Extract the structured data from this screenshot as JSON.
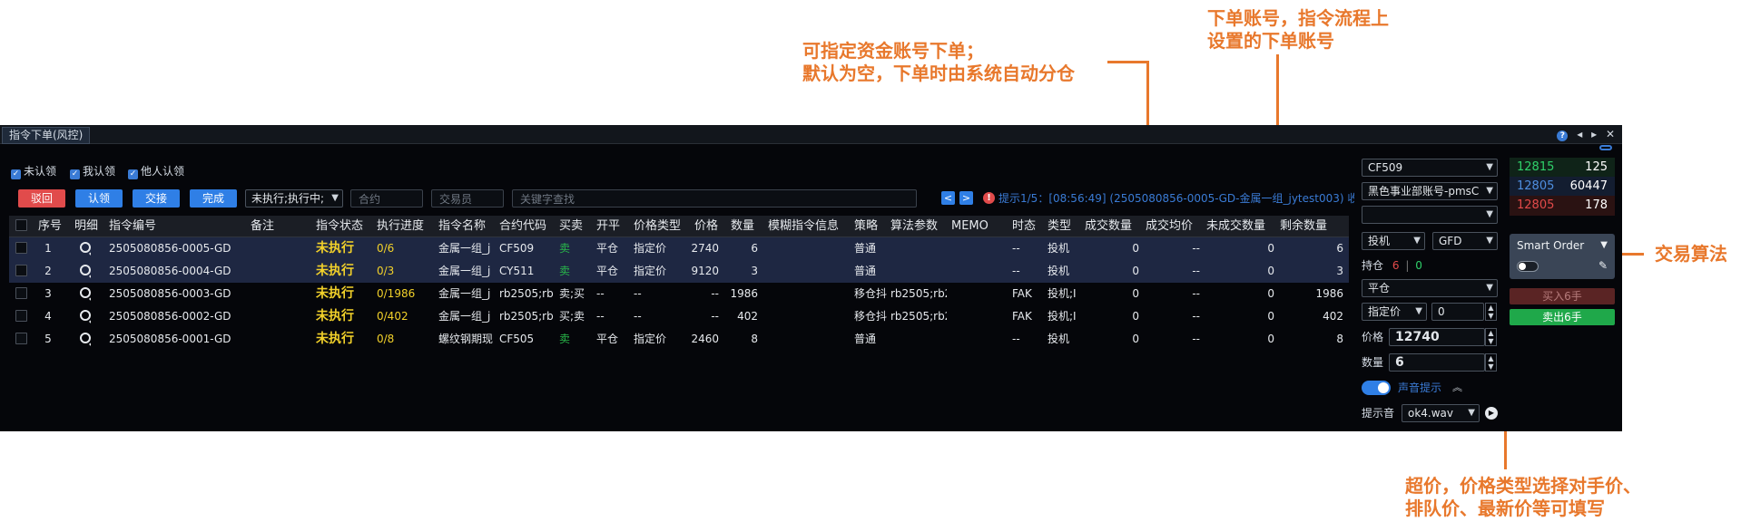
{
  "annotations": {
    "fund_account": [
      "可指定资金账号下单；",
      "默认为空，下单时由系统自动分仓"
    ],
    "order_account": [
      "下单账号，指令流程上",
      "设置的下单账号"
    ],
    "algo": "交易算法",
    "price": [
      "超价，价格类型选择对手价、",
      "排队价、最新价等可填写"
    ]
  },
  "window": {
    "tab": "指令下单(风控)",
    "icons": [
      "?",
      "◂",
      "▸",
      "✕"
    ]
  },
  "filters": {
    "checkboxes": [
      "未认领",
      "我认领",
      "他人认领"
    ],
    "check": "✓"
  },
  "buttons": {
    "reject": "驳回",
    "claim": "认领",
    "handover": "交接",
    "finish": "完成"
  },
  "search": {
    "status_select": "未执行;执行中;",
    "contract_placeholder": "合约",
    "trader_placeholder": "交易员",
    "keyword_placeholder": "关键字查找"
  },
  "notice": {
    "prev": "<",
    "next": ">",
    "text": "提示1/5：[08:56:49] (2505080856-0005-GD-金属一组_jytest003) 收"
  },
  "table": {
    "headers": [
      "序号",
      "明细",
      "指令编号",
      "备注",
      "指令状态",
      "执行进度",
      "指令名称",
      "合约代码",
      "买卖",
      "开平",
      "价格类型",
      "价格",
      "数量",
      "模糊指令信息",
      "策略",
      "算法参数",
      "MEMO",
      "时态",
      "类型",
      "成交数量",
      "成交均价",
      "未成交数量",
      "剩余数量"
    ],
    "rows": [
      {
        "seq": "1",
        "id": "2505080856-0005-GD",
        "note": "",
        "status": "未执行",
        "progress": "0/6",
        "name": "金属一组_j",
        "code": "CF509",
        "side": "卖",
        "oc": "平仓",
        "ptype": "指定价",
        "price": "2740",
        "qty": "6",
        "fuzzy": "",
        "strategy": "普通",
        "algo": "",
        "memo": "",
        "tif": "--",
        "type": "投机",
        "filled": "0",
        "avg": "--",
        "unfilled": "0",
        "remain": "6"
      },
      {
        "seq": "2",
        "id": "2505080856-0004-GD",
        "note": "",
        "status": "未执行",
        "progress": "0/3",
        "name": "金属一组_j",
        "code": "CY511",
        "side": "卖",
        "oc": "平仓",
        "ptype": "指定价",
        "price": "9120",
        "qty": "3",
        "fuzzy": "",
        "strategy": "普通",
        "algo": "",
        "memo": "",
        "tif": "--",
        "type": "投机",
        "filled": "0",
        "avg": "--",
        "unfilled": "0",
        "remain": "3"
      },
      {
        "seq": "3",
        "id": "2505080856-0003-GD",
        "note": "",
        "status": "未执行",
        "progress": "0/1986",
        "name": "金属一组_j",
        "code": "rb2505;rb",
        "side": "卖;买",
        "oc": "--",
        "ptype": "--",
        "price": "--",
        "qty": "1986",
        "fuzzy": "",
        "strategy": "移仓抖",
        "algo": "rb2505;rb2",
        "memo": "",
        "tif": "FAK",
        "type": "投机;I",
        "filled": "0",
        "avg": "--",
        "unfilled": "0",
        "remain": "1986"
      },
      {
        "seq": "4",
        "id": "2505080856-0002-GD",
        "note": "",
        "status": "未执行",
        "progress": "0/402",
        "name": "金属一组_j",
        "code": "rb2505;rb",
        "side": "买;卖",
        "oc": "--",
        "ptype": "--",
        "price": "--",
        "qty": "402",
        "fuzzy": "",
        "strategy": "移仓抖",
        "algo": "rb2505;rb2",
        "memo": "",
        "tif": "FAK",
        "type": "投机;I",
        "filled": "0",
        "avg": "--",
        "unfilled": "0",
        "remain": "402"
      },
      {
        "seq": "5",
        "id": "2505080856-0001-GD",
        "note": "",
        "status": "未执行",
        "progress": "0/8",
        "name": "螺纹钢期现",
        "code": "CF505",
        "side": "卖",
        "oc": "平仓",
        "ptype": "指定价",
        "price": "2460",
        "qty": "8",
        "fuzzy": "",
        "strategy": "普通",
        "algo": "",
        "memo": "",
        "tif": "--",
        "type": "投机",
        "filled": "0",
        "avg": "--",
        "unfilled": "0",
        "remain": "8"
      }
    ]
  },
  "order_panel": {
    "contract": "CF509",
    "order_account": "黑色事业部账号-pmsC",
    "fund_account": "",
    "hedge": "投机",
    "tif": "GFD",
    "position_label": "持仓",
    "position_long": "6",
    "position_sep": "|",
    "position_short": "0",
    "offset": "平仓",
    "price_type": "指定价",
    "price_offset": "0",
    "price_label": "价格",
    "price": "12740",
    "qty_label": "数量",
    "qty": "6",
    "sound_label": "声音提示",
    "sound_toggle": "on",
    "tone_label": "提示音",
    "tone": "ok4.wav"
  },
  "quotes": [
    {
      "price": "12815",
      "vol": "125",
      "color": "#2fd16a",
      "bg": "#0f2318"
    },
    {
      "price": "12805",
      "vol": "60447",
      "color": "#4f8fe0",
      "bg": "#131d30"
    },
    {
      "price": "12805",
      "vol": "178",
      "color": "#e24a4a",
      "bg": "#2a1212"
    }
  ],
  "algo": {
    "name": "Smart Order",
    "toggle": "off"
  },
  "trade_buttons": {
    "buy": "买入6手",
    "sell": "卖出6手"
  }
}
